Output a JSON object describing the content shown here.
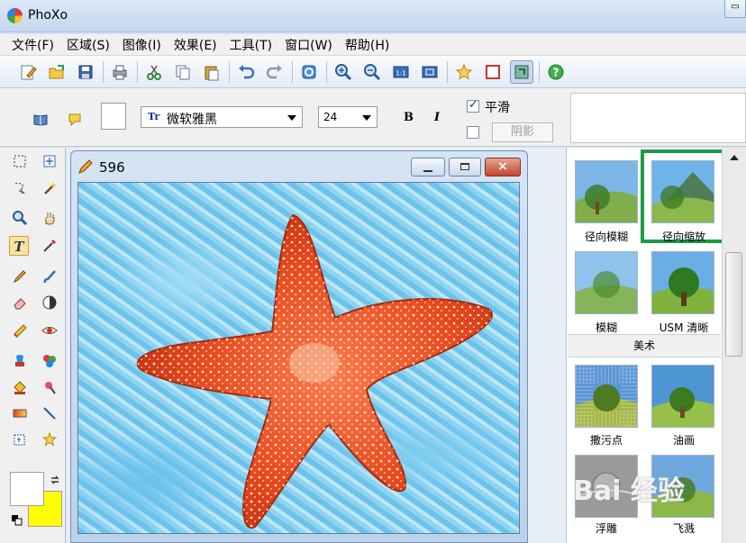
{
  "app": {
    "title": "PhoXo"
  },
  "menu": [
    "文件(F)",
    "区域(S)",
    "图像(I)",
    "效果(E)",
    "工具(T)",
    "窗口(W)",
    "帮助(H)"
  ],
  "toolbar": {
    "icons": [
      "new-icon",
      "open-icon",
      "save-icon",
      "print-icon",
      "cut-icon",
      "copy-icon",
      "paste-icon",
      "undo-icon",
      "redo-icon",
      "refresh-icon",
      "zoom-in-icon",
      "zoom-out-icon",
      "actual-size-icon",
      "fit-window-icon",
      "star-icon",
      "canvas-icon",
      "layer-icon",
      "help-icon"
    ]
  },
  "text_options": {
    "font": "微软雅黑",
    "font_prefix": "Tr",
    "size": "24",
    "bold": "B",
    "italic": "I",
    "smooth_label": "平滑",
    "smooth_checked": true,
    "shadow_label": "阴影",
    "shadow_checked": false
  },
  "colors": {
    "foreground": "#ffffff",
    "background": "#ffff00",
    "accent_selection": "#1d9a46"
  },
  "image_window": {
    "title": "596"
  },
  "effects": {
    "items_top": [
      {
        "label": "径向模糊",
        "selected": false
      },
      {
        "label": "径向缩放",
        "selected": true
      },
      {
        "label": "模糊",
        "selected": false
      },
      {
        "label": "USM 清晰",
        "selected": false
      }
    ],
    "section": "美术",
    "items_art": [
      {
        "label": "撒污点"
      },
      {
        "label": "油画"
      },
      {
        "label": "浮雕"
      },
      {
        "label": "飞溅"
      }
    ]
  },
  "watermark": "Bai 经验"
}
